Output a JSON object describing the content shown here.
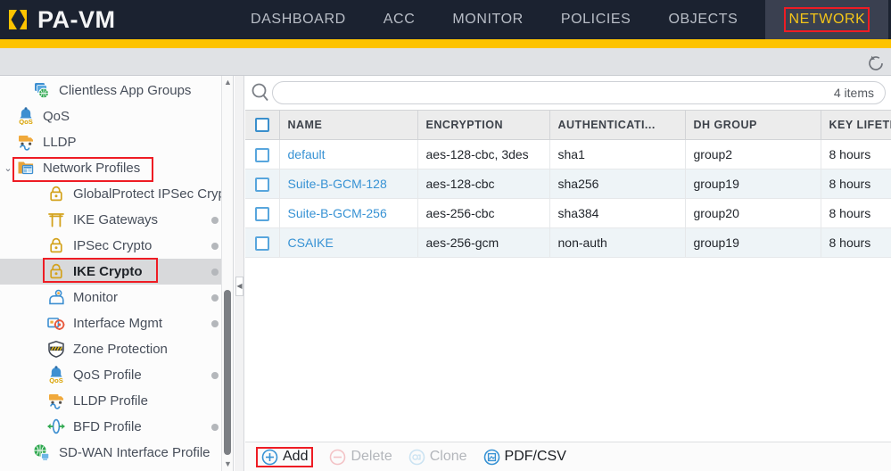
{
  "header": {
    "brand": "PA-VM",
    "logo_icon": "palo-alto-hexagon-logo",
    "tabs": [
      {
        "label": "DASHBOARD",
        "active": false
      },
      {
        "label": "ACC",
        "active": false
      },
      {
        "label": "MONITOR",
        "active": false
      },
      {
        "label": "POLICIES",
        "active": false
      },
      {
        "label": "OBJECTS",
        "active": false
      },
      {
        "label": "NETWORK",
        "active": true
      }
    ],
    "refresh_icon": "refresh-icon"
  },
  "sidebar": {
    "items": [
      {
        "label": "Clientless App Groups",
        "icon": "clientless-app-groups-icon",
        "indent": 1,
        "caret": "",
        "dot": false,
        "selected": false
      },
      {
        "label": "QoS",
        "icon": "qos-icon",
        "indent": 0,
        "caret": "",
        "dot": false,
        "selected": false
      },
      {
        "label": "LLDP",
        "icon": "lldp-truck-icon",
        "indent": 0,
        "caret": "",
        "dot": false,
        "selected": false
      },
      {
        "label": "Network Profiles",
        "icon": "network-profiles-folder-icon",
        "indent": 0,
        "caret": "⌄",
        "dot": false,
        "selected": false
      },
      {
        "label": "GlobalProtect IPSec Crypto",
        "icon": "padlock-icon",
        "indent": 2,
        "caret": "",
        "dot": false,
        "selected": false
      },
      {
        "label": "IKE Gateways",
        "icon": "ike-gateway-icon",
        "indent": 2,
        "caret": "",
        "dot": true,
        "selected": false
      },
      {
        "label": "IPSec Crypto",
        "icon": "padlock-icon",
        "indent": 2,
        "caret": "",
        "dot": true,
        "selected": false
      },
      {
        "label": "IKE Crypto",
        "icon": "padlock-icon",
        "indent": 2,
        "caret": "",
        "dot": true,
        "selected": true
      },
      {
        "label": "Monitor",
        "icon": "monitor-person-icon",
        "indent": 2,
        "caret": "",
        "dot": true,
        "selected": false
      },
      {
        "label": "Interface Mgmt",
        "icon": "interface-mgmt-icon",
        "indent": 2,
        "caret": "",
        "dot": true,
        "selected": false
      },
      {
        "label": "Zone Protection",
        "icon": "zone-protection-shield-icon",
        "indent": 2,
        "caret": "",
        "dot": false,
        "selected": false
      },
      {
        "label": "QoS Profile",
        "icon": "qos-icon",
        "indent": 2,
        "caret": "",
        "dot": true,
        "selected": false
      },
      {
        "label": "LLDP Profile",
        "icon": "lldp-truck-icon",
        "indent": 2,
        "caret": "",
        "dot": false,
        "selected": false
      },
      {
        "label": "BFD Profile",
        "icon": "bfd-profile-icon",
        "indent": 2,
        "caret": "",
        "dot": true,
        "selected": false
      },
      {
        "label": "SD-WAN Interface Profile",
        "icon": "sdwan-globe-icon",
        "indent": 1,
        "caret": "",
        "dot": false,
        "selected": false
      }
    ],
    "scroll_up_icon": "scroll-arrow-up-icon",
    "scroll_down_icon": "scroll-arrow-down-icon"
  },
  "search": {
    "value": "",
    "placeholder": "",
    "icon": "search-icon",
    "item_count": "4 items"
  },
  "table": {
    "columns": [
      "NAME",
      "ENCRYPTION",
      "AUTHENTICATI...",
      "DH GROUP",
      "KEY LIFETIME"
    ],
    "rows": [
      {
        "name": "default",
        "encryption": "aes-128-cbc, 3des",
        "authentication": "sha1",
        "dh_group": "group2",
        "key_lifetime": "8 hours",
        "checked": false
      },
      {
        "name": "Suite-B-GCM-128",
        "encryption": "aes-128-cbc",
        "authentication": "sha256",
        "dh_group": "group19",
        "key_lifetime": "8 hours",
        "checked": false
      },
      {
        "name": "Suite-B-GCM-256",
        "encryption": "aes-256-cbc",
        "authentication": "sha384",
        "dh_group": "group20",
        "key_lifetime": "8 hours",
        "checked": false
      },
      {
        "name": "CSAIKE",
        "encryption": "aes-256-gcm",
        "authentication": "non-auth",
        "dh_group": "group19",
        "key_lifetime": "8 hours",
        "checked": false
      }
    ]
  },
  "toolbar": {
    "add_label": "Add",
    "delete_label": "Delete",
    "clone_label": "Clone",
    "pdfcsv_label": "PDF/CSV",
    "add_icon": "plus-circle-icon",
    "delete_icon": "minus-circle-icon",
    "clone_icon": "clone-icon",
    "pdfcsv_icon": "pdf-csv-icon"
  },
  "colors": {
    "header_bg": "#1b2230",
    "gold_bar": "#fdc300",
    "accent_link": "#3792d4",
    "annotation_red": "#ee1c24",
    "active_tab_bg": "#3a4050",
    "selected_row_bg": "#d8d9db"
  }
}
